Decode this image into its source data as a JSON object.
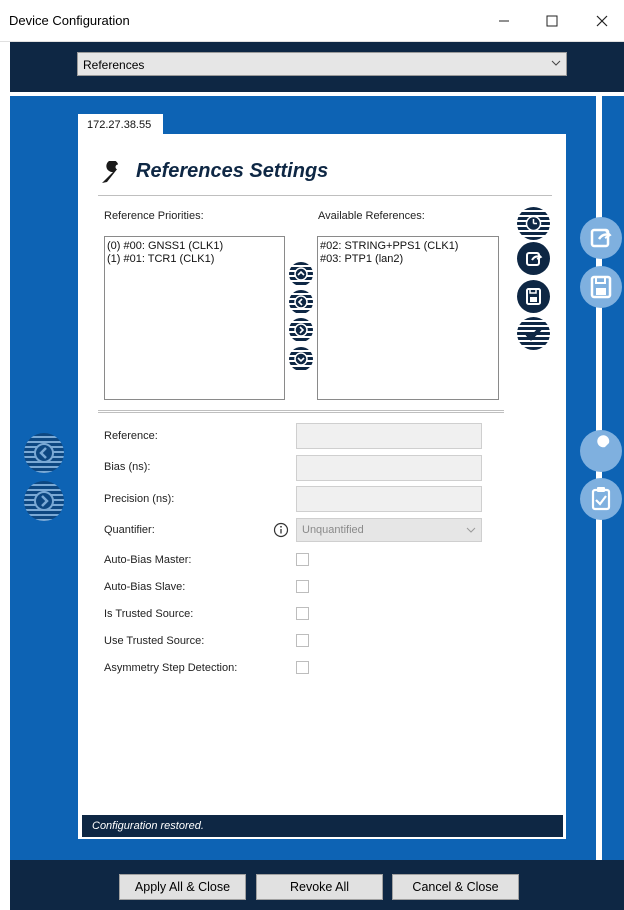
{
  "window": {
    "title": "Device Configuration"
  },
  "page_select": {
    "value": "References"
  },
  "tab": {
    "label": "172.27.38.55"
  },
  "panel": {
    "title": "References Settings"
  },
  "priorities": {
    "label": "Reference Priorities:",
    "items": [
      "(0) #00: GNSS1 (CLK1)",
      "(1) #01: TCR1 (CLK1)"
    ]
  },
  "available": {
    "label": "Available References:",
    "items": [
      "#02: STRING+PPS1 (CLK1)",
      "#03: PTP1 (lan2)"
    ]
  },
  "form": {
    "reference_label": "Reference:",
    "bias_label": "Bias (ns):",
    "precision_label": "Precision (ns):",
    "quantifier_label": "Quantifier:",
    "quantifier_value": "Unquantified",
    "auto_bias_master_label": "Auto-Bias Master:",
    "auto_bias_slave_label": "Auto-Bias Slave:",
    "is_trusted_label": "Is Trusted Source:",
    "use_trusted_label": "Use Trusted Source:",
    "asymmetry_label": "Asymmetry Step Detection:"
  },
  "status": {
    "text": "Configuration restored."
  },
  "buttons": {
    "apply_all": "Apply All & Close",
    "revoke_all": "Revoke All",
    "cancel_close": "Cancel & Close"
  },
  "icons": {
    "move_up": "move-up-icon",
    "move_left": "move-left-icon",
    "move_right": "move-right-icon",
    "move_down": "move-down-icon",
    "info": "info-icon",
    "wrench": "wrench-icon"
  },
  "colors": {
    "dark_navy": "#0e2744",
    "blue": "#0d63b4",
    "light_blue_icon": "#7fb0df"
  }
}
